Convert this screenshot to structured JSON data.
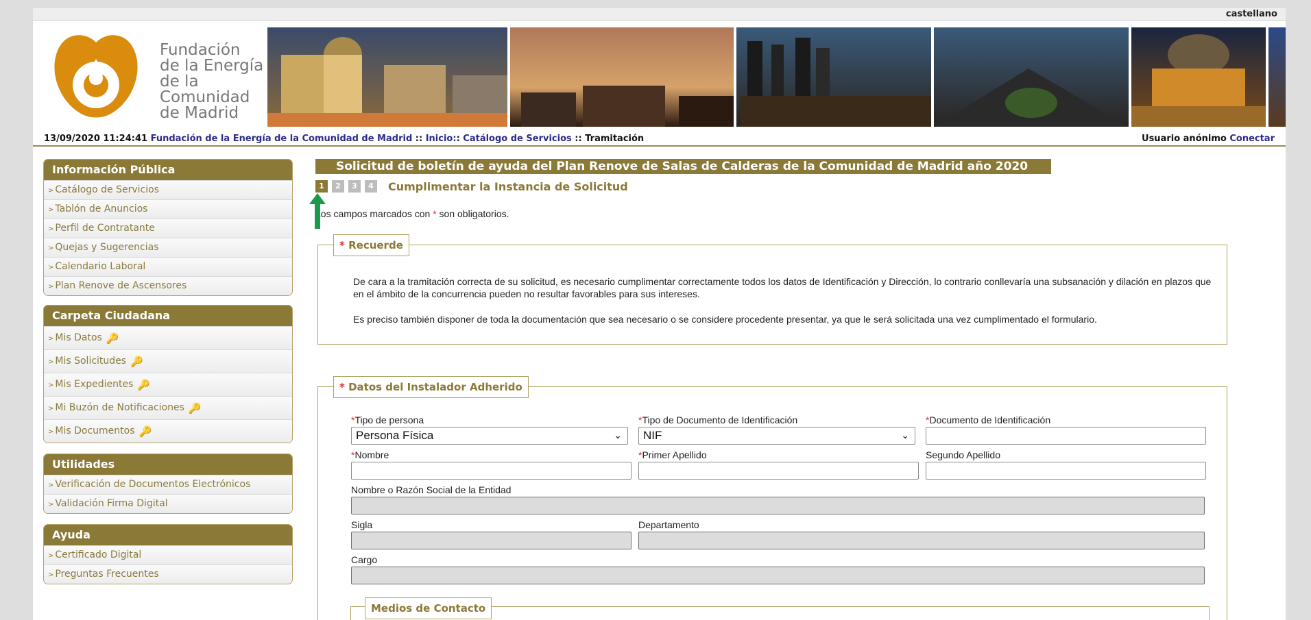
{
  "header": {
    "language": "castellano",
    "logo_lines": [
      "Fundación",
      "de la Energía",
      "de la",
      "Comunidad",
      "de Madrid"
    ],
    "datetime": "13/09/2020 11:24:41",
    "breadcrumb": {
      "org": "Fundación de la Energía de la Comunidad de Madrid",
      "sep1": "::",
      "inicio": "Inicio:",
      "sep2": ":",
      "catalogo": "Catálogo de Servicios",
      "sep3": "::",
      "current": "Tramitación"
    },
    "user_label": "Usuario anónimo",
    "connect_label": "Conectar"
  },
  "sidebar": {
    "publica": {
      "title": "Información Pública",
      "items": [
        "Catálogo de Servicios",
        "Tablón de Anuncios",
        "Perfil de Contratante",
        "Quejas y Sugerencias",
        "Calendario Laboral",
        "Plan Renove de Ascensores"
      ]
    },
    "carpeta": {
      "title": "Carpeta Ciudadana",
      "items": [
        "Mis Datos",
        "Mis Solicitudes",
        "Mis Expedientes",
        "Mi Buzón de Notificaciones",
        "Mis Documentos"
      ]
    },
    "utilidades": {
      "title": "Utilidades",
      "items": [
        "Verificación de Documentos Electrónicos",
        "Validación Firma Digital"
      ]
    },
    "ayuda": {
      "title": "Ayuda",
      "items": [
        "Certificado Digital",
        "Preguntas Frecuentes"
      ]
    },
    "bullet": ">"
  },
  "main": {
    "title": "Solicitud de boletín de ayuda del Plan Renove de Salas de Calderas de la Comunidad de Madrid año 2020",
    "steps": [
      "1",
      "2",
      "3",
      "4"
    ],
    "active_step": 1,
    "step_label": "Cumplimentar la Instancia de Solicitud",
    "required_note_pre": "Los campos marcados con",
    "required_note_post": "son obligatorios.",
    "asterisk": "*",
    "recuerde": {
      "legend": "Recuerde",
      "p1": "De cara a la tramitación correcta de su solicitud, es necesario cumplimentar correctamente todos los datos de Identificación y Dirección, lo contrario conllevaría una subsanación y dilación en plazos que en el ámbito de la concurrencia pueden no resultar favorables para sus intereses.",
      "p2": "Es preciso también disponer de toda la documentación que sea necesario o se considere procedente presentar, ya que le será solicitada una vez cumplimentado el formulario."
    },
    "instalador": {
      "legend": "Datos del Instalador Adherido",
      "tipo_persona": {
        "label": "Tipo de persona",
        "value": "Persona Física"
      },
      "tipo_documento": {
        "label": "Tipo de Documento de Identificación",
        "value": "NIF"
      },
      "documento": {
        "label": "Documento de Identificación",
        "value": ""
      },
      "nombre": {
        "label": "Nombre",
        "value": ""
      },
      "primer_apellido": {
        "label": "Primer Apellido",
        "value": ""
      },
      "segundo_apellido": {
        "label": "Segundo Apellido",
        "value": ""
      },
      "razon_social": {
        "label": "Nombre o Razón Social de la Entidad",
        "value": ""
      },
      "sigla": {
        "label": "Sigla",
        "value": ""
      },
      "departamento": {
        "label": "Departamento",
        "value": ""
      },
      "cargo": {
        "label": "Cargo",
        "value": ""
      }
    },
    "contacto": {
      "legend": "Medios de Contacto"
    }
  },
  "colors": {
    "brand": "#8b7937",
    "logo_orange": "#d98c0d",
    "required": "#e0272b",
    "link": "#2a2a8a",
    "arrow": "#1a9a4a"
  },
  "icons": {
    "key": "key-icon",
    "arrow": "up-arrow-icon",
    "dropdown": "chevron-down-icon"
  }
}
